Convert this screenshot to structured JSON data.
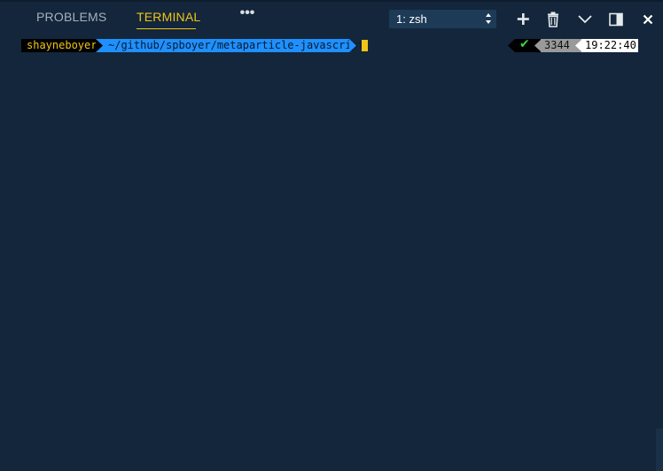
{
  "header": {
    "tabs": [
      {
        "label": "PROBLEMS",
        "active": false
      },
      {
        "label": "TERMINAL",
        "active": true
      }
    ],
    "more_label": "•••",
    "shell_select": {
      "selected": "1: zsh"
    },
    "actions": [
      "plus-icon",
      "trash-icon",
      "chevron-down-icon",
      "split-panel-icon",
      "close-icon"
    ]
  },
  "terminal": {
    "prompt": {
      "user": "shayneboyer",
      "path": "~/github/spboyer/metaparticle-javascript"
    },
    "right_prompt": {
      "status_icon": "check-icon",
      "history_number": "3344",
      "time": "19:22:40"
    }
  },
  "colors": {
    "background": "#13263b",
    "accent": "#f0c419",
    "path_segment": "#1e90ff",
    "success": "#3cd13c"
  }
}
